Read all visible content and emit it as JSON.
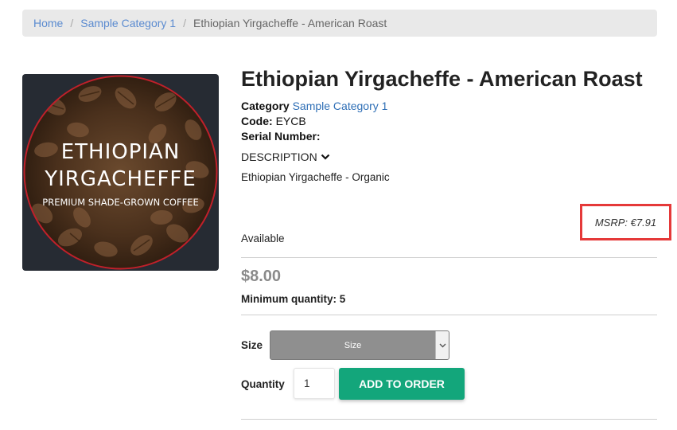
{
  "breadcrumb": {
    "home": "Home",
    "category": "Sample Category 1",
    "current": "Ethiopian Yirgacheffe - American Roast"
  },
  "image": {
    "line1": "ETHIOPIAN",
    "line2": "YIRGACHEFFE",
    "line3": "PREMIUM SHADE-GROWN COFFEE"
  },
  "product": {
    "title": "Ethiopian Yirgacheffe - American Roast",
    "category_label": "Category",
    "category_value": "Sample Category 1",
    "code_label": "Code:",
    "code_value": "EYCB",
    "serial_label": "Serial Number:",
    "description_label": "DESCRIPTION",
    "description_text": "Ethiopian Yirgacheffe - Organic",
    "msrp": "MSRP: €7.91",
    "availability": "Available",
    "price": "$8.00",
    "min_qty": "Minimum quantity: 5"
  },
  "order": {
    "size_label": "Size",
    "size_value": "Size",
    "quantity_label": "Quantity",
    "quantity_value": "1",
    "add_button": "ADD TO ORDER"
  },
  "colors": {
    "accent_green": "#13a67b",
    "highlight_red": "#e53939",
    "link_blue": "#2f6fb6"
  }
}
